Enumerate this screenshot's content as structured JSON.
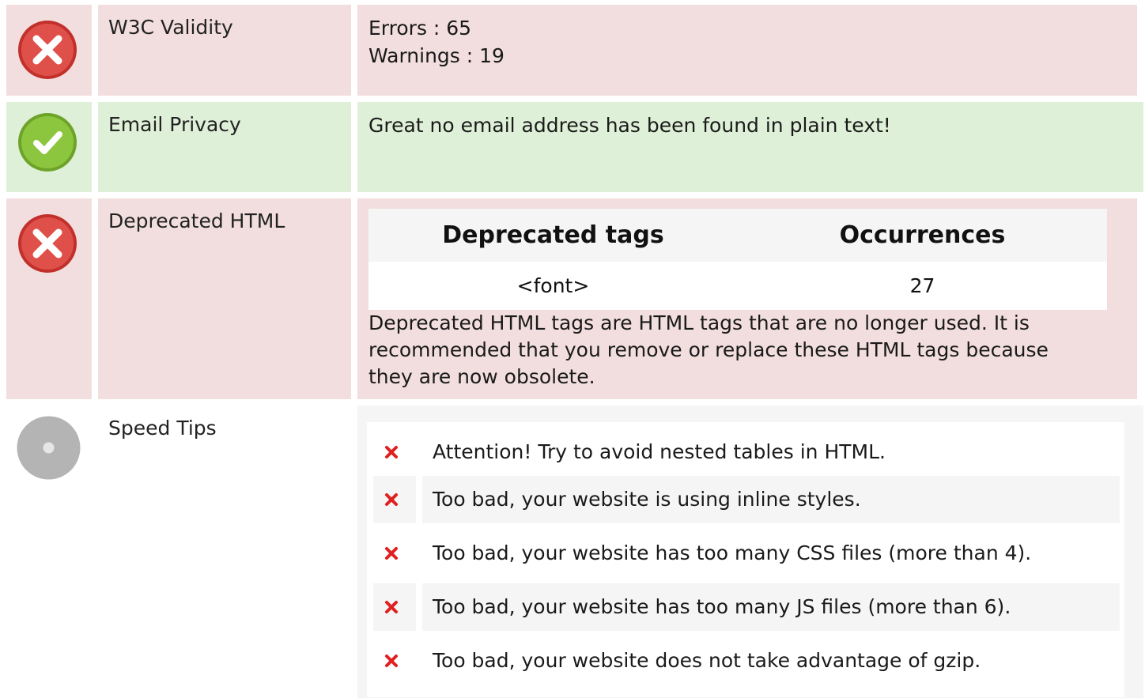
{
  "rows": {
    "w3c": {
      "icon": "error-x-icon",
      "label": "W3C Validity",
      "errors": "Errors : 65",
      "warnings": "Warnings : 19"
    },
    "email": {
      "icon": "success-check-icon",
      "label": "Email Privacy",
      "message": "Great no email address has been found in plain text!"
    },
    "deprecated": {
      "icon": "error-x-icon",
      "label": "Deprecated HTML",
      "table": {
        "headers": [
          "Deprecated tags",
          "Occurrences"
        ],
        "rows": [
          [
            "<font>",
            "27"
          ]
        ]
      },
      "description_lines": [
        "Deprecated HTML tags are HTML tags that are no longer used. It is",
        "recommended that you remove or replace these HTML tags because",
        "they are now obsolete."
      ]
    },
    "speed": {
      "icon": "neutral-dot-icon",
      "label": "Speed Tips",
      "tips": [
        "Attention! Try to avoid nested tables in HTML.",
        "Too bad, your website is using inline styles.",
        "Too bad, your website has too many CSS files (more than 4).",
        "Too bad, your website has too many JS files (more than 6).",
        "Too bad, your website does not take advantage of gzip."
      ]
    }
  },
  "colors": {
    "error_bg": "#f2dede",
    "success_bg": "#dff0d8",
    "error_icon": "#d9443f",
    "success_icon": "#8cc63e",
    "neutral_icon": "#b4b4b4",
    "tip_x": "#e02020"
  }
}
